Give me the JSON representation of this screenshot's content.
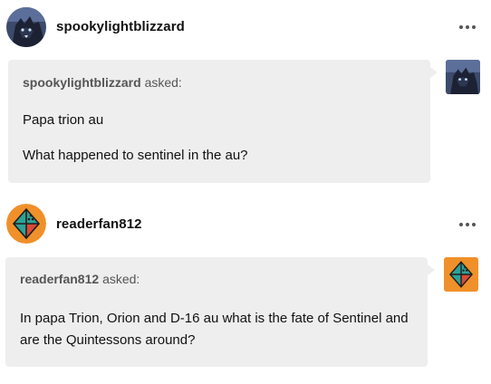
{
  "posts": [
    {
      "username": "spookylightblizzard",
      "asker": "spookylightblizzard",
      "asked_suffix": "asked:",
      "question_lines": [
        "Papa trion au",
        "What happened to sentinel in the au?"
      ]
    },
    {
      "username": "readerfan812",
      "asker": "readerfan812",
      "asked_suffix": "asked:",
      "question": "In papa Trion, Orion and D-16 au what is the fate of Sentinel and are the Quintessons around?"
    }
  ],
  "icons": {
    "more": "more-dots-icon",
    "avatar1": "wolf-avatar-icon",
    "avatar2": "diamond-avatar-icon"
  },
  "colors": {
    "bubble": "#eeeeee",
    "diamond_bg": "#f0902a",
    "diamond_teal": "#2fa197",
    "diamond_red": "#d94a38"
  }
}
